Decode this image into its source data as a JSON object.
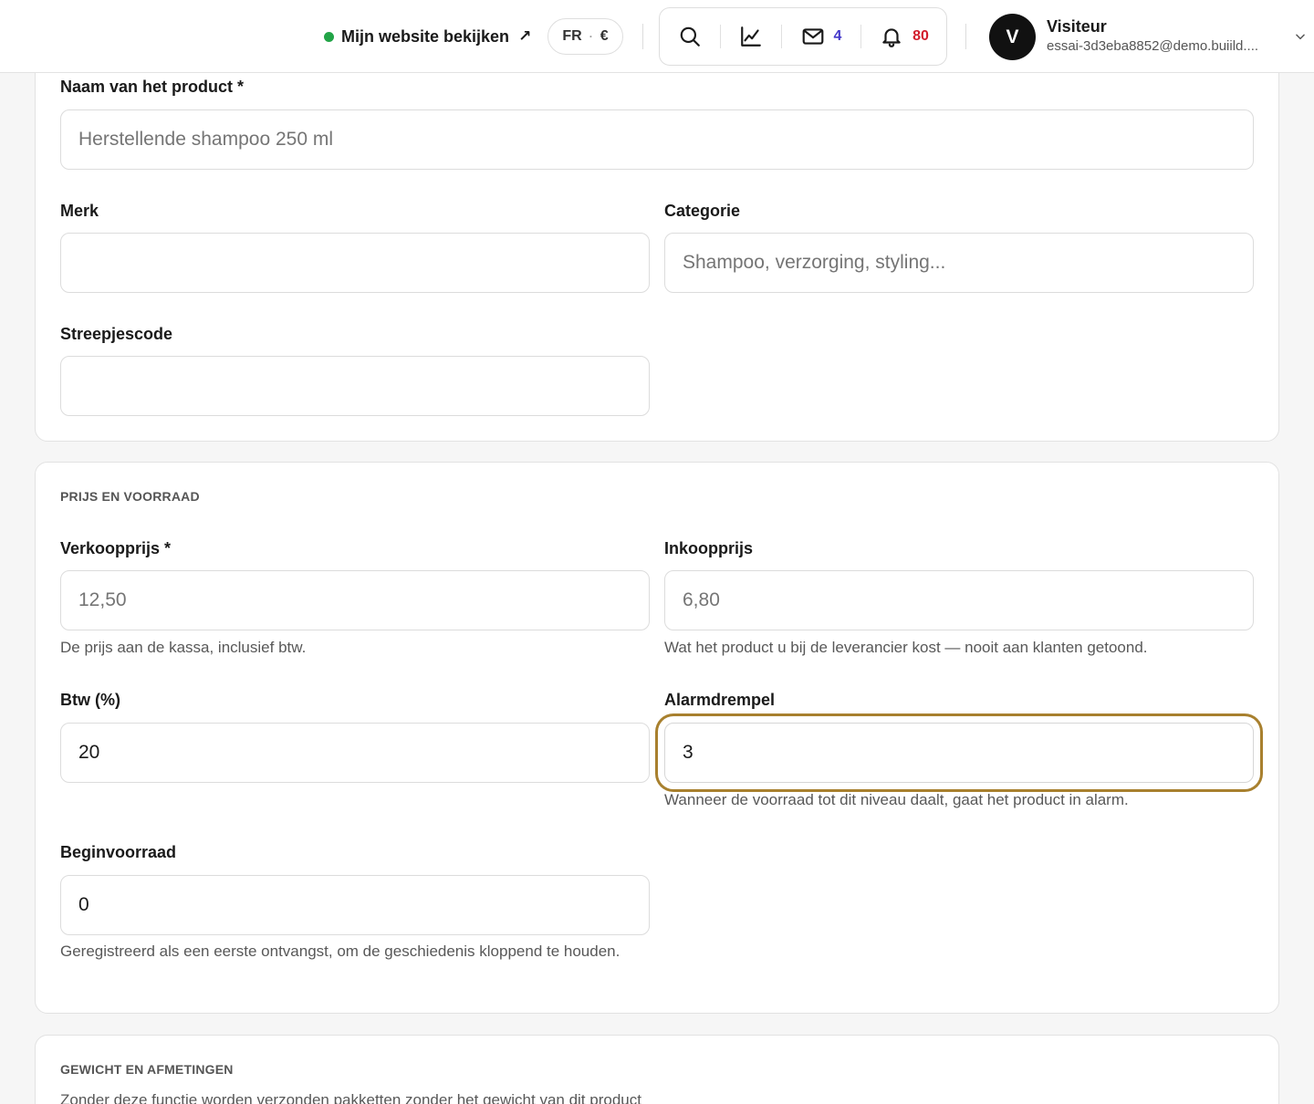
{
  "header": {
    "site_link_label": "Mijn website bekijken",
    "site_link_arrow": "↗",
    "lang": "FR",
    "currency": "€",
    "messages_count": "4",
    "notifications_count": "80",
    "user": {
      "initial": "V",
      "name": "Visiteur",
      "email": "essai-3d3eba8852@demo.buiild...."
    }
  },
  "product": {
    "name_label": "Naam van het product *",
    "name_placeholder": "Herstellende shampoo 250 ml",
    "brand_label": "Merk",
    "brand_value": "",
    "category_label": "Categorie",
    "category_placeholder": "Shampoo, verzorging, styling...",
    "barcode_label": "Streepjescode",
    "barcode_value": ""
  },
  "pricing": {
    "section_title": "PRIJS EN VOORRAAD",
    "sale_price_label": "Verkoopprijs *",
    "sale_price_placeholder": "12,50",
    "sale_price_help": "De prijs aan de kassa, inclusief btw.",
    "purchase_price_label": "Inkoopprijs",
    "purchase_price_placeholder": "6,80",
    "purchase_price_help": "Wat het product u bij de leverancier kost — nooit aan klanten getoond.",
    "vat_label": "Btw (%)",
    "vat_value": "20",
    "alarm_label": "Alarmdrempel",
    "alarm_value": "3",
    "alarm_help": "Wanneer de voorraad tot dit niveau daalt, gaat het product in alarm.",
    "initial_stock_label": "Beginvoorraad",
    "initial_stock_value": "0",
    "initial_stock_help": "Geregistreerd als een eerste ontvangst, om de geschiedenis kloppend te houden."
  },
  "dimensions": {
    "section_title": "GEWICHT EN AFMETINGEN",
    "intro_text": "Zonder deze functie worden verzonden pakketten zonder het gewicht van dit product"
  },
  "colors": {
    "focus_ring": "#a8802e",
    "online_dot": "#22a447",
    "messages_accent": "#4338ca",
    "notifications_accent": "#d21c2c"
  },
  "icons": [
    "search-icon",
    "chart-icon",
    "mail-icon",
    "bell-icon",
    "chevron-down-icon",
    "external-link-icon"
  ]
}
